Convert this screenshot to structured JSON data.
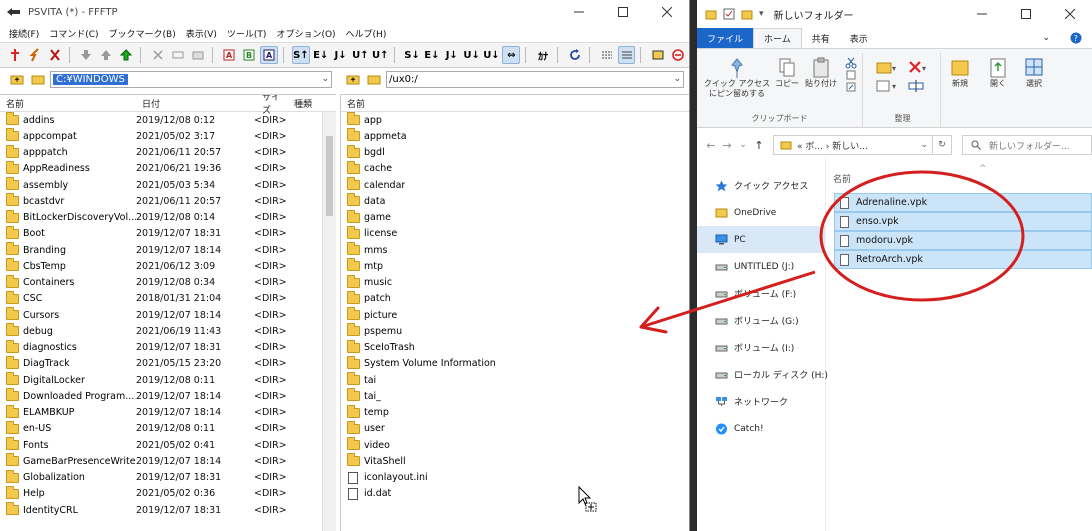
{
  "ffftp": {
    "title": "PSVITA (*) - FFFTP",
    "menu": [
      "接続(F)",
      "コマンド(C)",
      "ブックマーク(B)",
      "表示(V)",
      "ツール(T)",
      "オプション(O)",
      "ヘルプ(H)"
    ],
    "toolbar_text_buttons": [
      "S↑",
      "E↓",
      "J↓",
      "U↑",
      "U↑",
      "S↓",
      "E↓",
      "J↓",
      "U↓",
      "U↓",
      "⇔",
      "ｶﾅ"
    ],
    "local_path": "C:¥WINDOWS",
    "remote_path": "/ux0:/",
    "local_columns": [
      "名前",
      "日付",
      "サイズ",
      "種類"
    ],
    "remote_columns": [
      "名前"
    ],
    "local_rows": [
      {
        "name": "addins",
        "date": "2019/12/08 0:12",
        "size": "<DIR>"
      },
      {
        "name": "appcompat",
        "date": "2021/05/02 3:17",
        "size": "<DIR>"
      },
      {
        "name": "apppatch",
        "date": "2021/06/11 20:57",
        "size": "<DIR>"
      },
      {
        "name": "AppReadiness",
        "date": "2021/06/21 19:36",
        "size": "<DIR>"
      },
      {
        "name": "assembly",
        "date": "2021/05/03 5:34",
        "size": "<DIR>"
      },
      {
        "name": "bcastdvr",
        "date": "2021/06/11 20:57",
        "size": "<DIR>"
      },
      {
        "name": "BitLockerDiscoveryVol...",
        "date": "2019/12/08 0:14",
        "size": "<DIR>"
      },
      {
        "name": "Boot",
        "date": "2019/12/07 18:31",
        "size": "<DIR>"
      },
      {
        "name": "Branding",
        "date": "2019/12/07 18:14",
        "size": "<DIR>"
      },
      {
        "name": "CbsTemp",
        "date": "2021/06/12 3:09",
        "size": "<DIR>"
      },
      {
        "name": "Containers",
        "date": "2019/12/08 0:34",
        "size": "<DIR>"
      },
      {
        "name": "CSC",
        "date": "2018/01/31 21:04",
        "size": "<DIR>"
      },
      {
        "name": "Cursors",
        "date": "2019/12/07 18:14",
        "size": "<DIR>"
      },
      {
        "name": "debug",
        "date": "2021/06/19 11:43",
        "size": "<DIR>"
      },
      {
        "name": "diagnostics",
        "date": "2019/12/07 18:31",
        "size": "<DIR>"
      },
      {
        "name": "DiagTrack",
        "date": "2021/05/15 23:20",
        "size": "<DIR>"
      },
      {
        "name": "DigitalLocker",
        "date": "2019/12/08 0:11",
        "size": "<DIR>"
      },
      {
        "name": "Downloaded Program...",
        "date": "2019/12/07 18:14",
        "size": "<DIR>"
      },
      {
        "name": "ELAMBKUP",
        "date": "2019/12/07 18:14",
        "size": "<DIR>"
      },
      {
        "name": "en-US",
        "date": "2019/12/08 0:11",
        "size": "<DIR>"
      },
      {
        "name": "Fonts",
        "date": "2021/05/02 0:41",
        "size": "<DIR>"
      },
      {
        "name": "GameBarPresenceWriter",
        "date": "2019/12/07 18:14",
        "size": "<DIR>"
      },
      {
        "name": "Globalization",
        "date": "2019/12/07 18:31",
        "size": "<DIR>"
      },
      {
        "name": "Help",
        "date": "2021/05/02 0:36",
        "size": "<DIR>"
      },
      {
        "name": "IdentityCRL",
        "date": "2019/12/07 18:31",
        "size": "<DIR>"
      }
    ],
    "remote_rows": [
      {
        "name": "app",
        "type": "folder"
      },
      {
        "name": "appmeta",
        "type": "folder"
      },
      {
        "name": "bgdl",
        "type": "folder"
      },
      {
        "name": "cache",
        "type": "folder"
      },
      {
        "name": "calendar",
        "type": "folder"
      },
      {
        "name": "data",
        "type": "folder"
      },
      {
        "name": "game",
        "type": "folder"
      },
      {
        "name": "license",
        "type": "folder"
      },
      {
        "name": "mms",
        "type": "folder"
      },
      {
        "name": "mtp",
        "type": "folder"
      },
      {
        "name": "music",
        "type": "folder"
      },
      {
        "name": "patch",
        "type": "folder"
      },
      {
        "name": "picture",
        "type": "folder"
      },
      {
        "name": "pspemu",
        "type": "folder"
      },
      {
        "name": "SceIoTrash",
        "type": "folder"
      },
      {
        "name": "System Volume Information",
        "type": "folder"
      },
      {
        "name": "tai",
        "type": "folder"
      },
      {
        "name": "tai_",
        "type": "folder"
      },
      {
        "name": "temp",
        "type": "folder"
      },
      {
        "name": "user",
        "type": "folder"
      },
      {
        "name": "video",
        "type": "folder"
      },
      {
        "name": "VitaShell",
        "type": "folder"
      },
      {
        "name": "iconlayout.ini",
        "type": "file"
      },
      {
        "name": "id.dat",
        "type": "file"
      }
    ]
  },
  "explorer": {
    "title": "新しいフォルダー",
    "tabs": [
      "ファイル",
      "ホーム",
      "共有",
      "表示"
    ],
    "ribbon": {
      "pin_label": "クイック アクセス\nにピン留めする",
      "copy_label": "コピー",
      "paste_label": "貼り付け",
      "clipboard_group": "クリップボード",
      "organize_group": "整理",
      "new_label": "新規",
      "open_label": "開く",
      "select_label": "選択"
    },
    "address": "« ボ... › 新しい...",
    "search_placeholder": "新しいフォルダー...",
    "column_name": "名前",
    "nav": [
      {
        "label": "クイック アクセス",
        "icon": "star-icon"
      },
      {
        "label": "OneDrive",
        "icon": "folder-icon"
      },
      {
        "label": "PC",
        "icon": "pc-icon"
      },
      {
        "label": "UNTITLED (J:)",
        "icon": "drive-icon"
      },
      {
        "label": "ボリューム (F:)",
        "icon": "drive-icon"
      },
      {
        "label": "ボリューム (G:)",
        "icon": "drive-icon"
      },
      {
        "label": "ボリューム (I:)",
        "icon": "drive-icon"
      },
      {
        "label": "ローカル ディスク (H:)",
        "icon": "drive-icon"
      },
      {
        "label": "ネットワーク",
        "icon": "network-icon"
      },
      {
        "label": "Catch!",
        "icon": "catch-icon"
      }
    ],
    "files": [
      "Adrenaline.vpk",
      "enso.vpk",
      "modoru.vpk",
      "RetroArch.vpk"
    ]
  },
  "colors": {
    "accent_blue": "#1b66c9",
    "selection": "#cce4f7",
    "annotation_red": "#d41f1f"
  }
}
